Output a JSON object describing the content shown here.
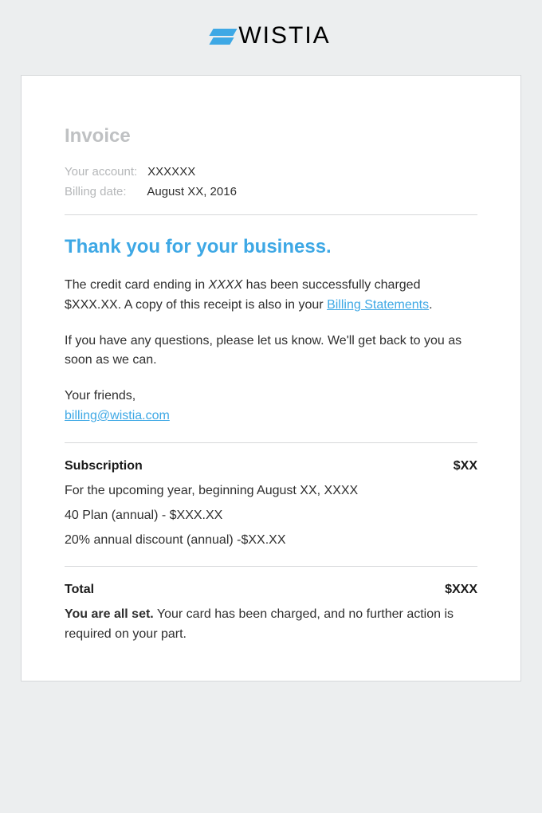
{
  "logo": {
    "text": "WISTIA"
  },
  "header": {
    "title": "Invoice",
    "account_label": "Your account:",
    "account_value": "XXXXXX",
    "billing_date_label": "Billing date:",
    "billing_date_value": "August XX, 2016"
  },
  "message": {
    "heading": "Thank you for your business.",
    "line1_prefix": "The credit card ending in ",
    "line1_card": "XXXX",
    "line1_mid": " has been successfully charged $XXX.XX. A copy of this receipt is also in your ",
    "line1_link": "Billing Statements",
    "line1_suffix": ".",
    "line2": "If you have any questions, please let us know. We'll get back to you as soon as we can.",
    "signoff": "Your friends,",
    "email": "billing@wistia.com"
  },
  "subscription": {
    "label": "Subscription",
    "amount": "$XX",
    "period": "For the upcoming year, beginning August XX, XXXX",
    "plan": "40 Plan (annual) - $XXX.XX",
    "discount": "20% annual discount (annual) -$XX.XX"
  },
  "total": {
    "label": "Total",
    "amount": "$XXX"
  },
  "confirmation": {
    "bold": "You are all set.",
    "rest": " Your card has been charged, and no further action is required on your part."
  }
}
